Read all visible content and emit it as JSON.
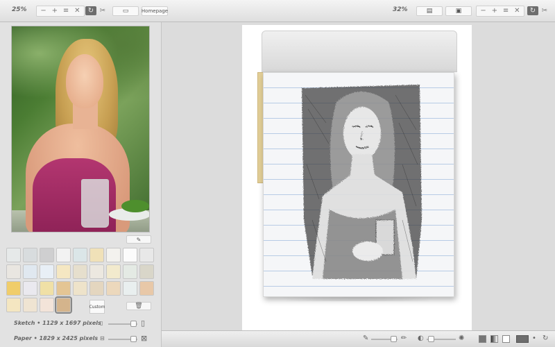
{
  "toolbar_left": {
    "zoom_label": "25%",
    "homepage_label": "Homepage"
  },
  "toolbar_right": {
    "zoom_label": "32%"
  },
  "left_panel": {
    "sketch_info": "Sketch  •  1129 x 1697 pixels",
    "paper_info": "Paper  •  1829 x 2425 pixels",
    "custom_label": "Custom",
    "paper_swatches": [
      "#e6e9e9",
      "#d8dcde",
      "#cfcfd0",
      "#f2f2f2",
      "#dbe6e8",
      "#f0e1b8",
      "#f3f2ee",
      "#fbfbfb",
      "#e8e8e8",
      "#e9e6e1",
      "#e0e8f0",
      "#e8eff6",
      "#f5e7c2",
      "#e6dfcd",
      "#ece8e0",
      "#f2eacd",
      "#e4eae4",
      "#d9d6c9",
      "#f0cd6a",
      "#eae9ef",
      "#f0e0a6",
      "#e4c594",
      "#eee3ca",
      "#e4d6bf",
      "#ecd8bc",
      "#e9efef",
      "#e8c8a8",
      "#f1e7bf",
      "#f4e6c1",
      "#efe4d2",
      "#f3e4d9",
      "#d4b48c"
    ],
    "selected_swatch_index": 31
  },
  "colors": {
    "panel_bg": "#e2e2e2",
    "toolbar_bg": "#e8e8e8",
    "canvas_bg": "#ffffff",
    "paper_line": "#b7cbe5"
  }
}
